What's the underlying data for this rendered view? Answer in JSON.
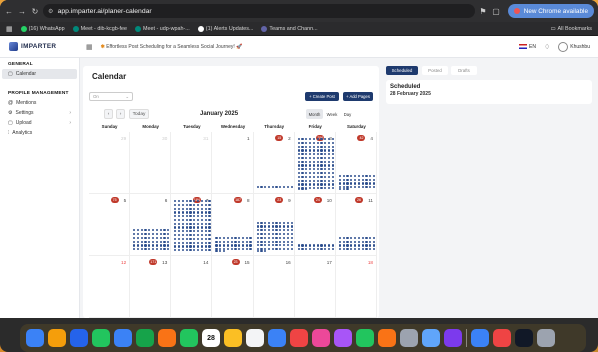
{
  "browser": {
    "url": "app.imparter.ai/planer-calendar",
    "new_chrome": "New Chrome available",
    "right_icons": "⊕ ⌕ ☆"
  },
  "bookmarks": {
    "items": [
      "(16) WhatsApp",
      "Meet - dib-kcgb-fee",
      "Meet - udp-wpah-...",
      "(1) Alerts Updates...",
      "Teams and Chann..."
    ],
    "all": "All Bookmarks"
  },
  "app": {
    "logo": "IMPARTER",
    "tagline_prefix": "✱",
    "tagline": "Effortless Post Scheduling for a Seamless Social Journey! 🚀",
    "lang": "EN",
    "user": "Khushbu"
  },
  "sidebar": {
    "general": "GENERAL",
    "calendar": "Calendar",
    "profile_mgmt": "PROFILE MANAGEMENT",
    "items": [
      "Mentions",
      "Settings",
      "Upload",
      "Analytics"
    ]
  },
  "calendar": {
    "title": "Calendar",
    "select_placeholder": "On",
    "create_post": "+ Create Post",
    "add_pages": "+ Add Pages",
    "today": "Today",
    "month_title": "January 2025",
    "views": [
      "Month",
      "Week",
      "Day"
    ],
    "days": [
      "Sunday",
      "Monday",
      "Tuesday",
      "Wednesday",
      "Thursday",
      "Friday",
      "Saturday"
    ],
    "weeks": [
      [
        {
          "n": "29",
          "f": true
        },
        {
          "n": "30",
          "f": true
        },
        {
          "n": "31",
          "f": true
        },
        {
          "n": "1"
        },
        {
          "n": "2",
          "b": "15",
          "d": [
            10,
            1
          ]
        },
        {
          "n": "3",
          "b": "256",
          "d": [
            10,
            14,
            1,
            1
          ]
        },
        {
          "n": "4",
          "b": "42",
          "d": [
            10,
            4,
            1
          ]
        }
      ],
      [
        {
          "n": "5",
          "b": "75"
        },
        {
          "n": "6",
          "d": [
            10,
            6
          ]
        },
        {
          "n": "7",
          "b": "184",
          "d": [
            10,
            14
          ]
        },
        {
          "n": "8",
          "b": "187",
          "d": [
            10,
            4,
            1
          ]
        },
        {
          "n": "9",
          "b": "23",
          "d": [
            10,
            8,
            1
          ]
        },
        {
          "n": "10",
          "b": "24",
          "d": [
            10,
            2
          ]
        },
        {
          "n": "11",
          "b": "26",
          "d": [
            10,
            4
          ]
        }
      ],
      [
        {
          "n": "12",
          "t": true
        },
        {
          "n": "13",
          "b": "171"
        },
        {
          "n": "14"
        },
        {
          "n": "15",
          "b": "23"
        },
        {
          "n": "16"
        },
        {
          "n": "17"
        },
        {
          "n": "18",
          "t": true
        }
      ]
    ]
  },
  "right_panel": {
    "tabs": [
      "Scheduled",
      "Posted",
      "Drafts"
    ],
    "heading": "Scheduled",
    "date": "28 February 2025"
  },
  "dock": [
    "Finder",
    "Launchpad",
    "Safari",
    "Messages",
    "Mail",
    "Maps",
    "Photos",
    "FaceTime",
    "28",
    "Notes",
    "Reminders",
    "Keynote",
    "Chrome",
    "Music",
    "Podcasts",
    "Numbers",
    "Pages",
    "Settings",
    "Preview",
    "Slack",
    "Xcode",
    "Office",
    "Terminal",
    "Trash"
  ]
}
